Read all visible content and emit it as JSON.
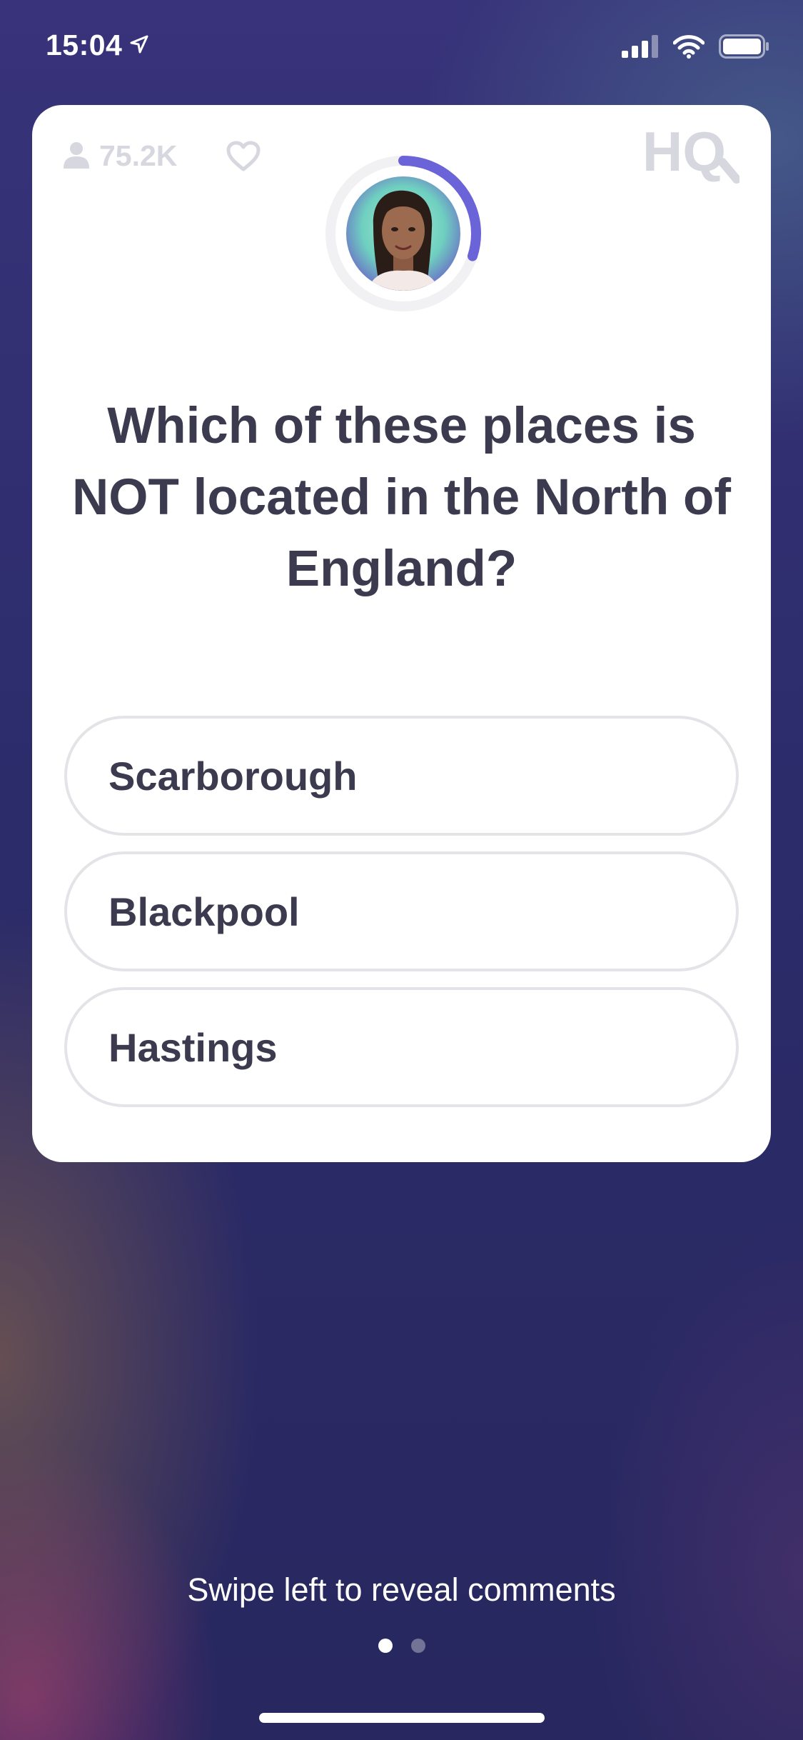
{
  "status_bar": {
    "time": "15:04",
    "icons": [
      "location-arrow-icon",
      "cellular-signal-icon",
      "wifi-icon",
      "battery-icon"
    ]
  },
  "card": {
    "viewer_count": "75.2K",
    "logo": "HQ",
    "question": "Which of these places is NOT located in the North of England?",
    "answers": [
      {
        "label": "Scarborough"
      },
      {
        "label": "Blackpool"
      },
      {
        "label": "Hastings"
      }
    ],
    "timer_progress": 0.3,
    "colors": {
      "timer_ring": "#6b63d8",
      "timer_track": "#f1f1f3",
      "text": "#3b3a4e",
      "muted": "#d7d7df"
    }
  },
  "footer": {
    "swipe_hint": "Swipe left to reveal comments",
    "page_count": 2,
    "active_page": 1
  }
}
